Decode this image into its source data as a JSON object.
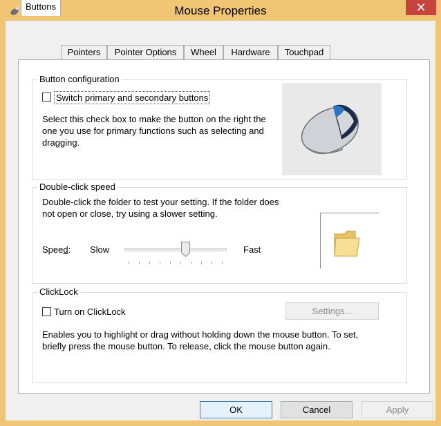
{
  "window": {
    "title": "Mouse Properties",
    "close_label": "✕"
  },
  "tabs": [
    {
      "label": "Buttons",
      "active": true
    },
    {
      "label": "Pointers",
      "active": false
    },
    {
      "label": "Pointer Options",
      "active": false
    },
    {
      "label": "Wheel",
      "active": false
    },
    {
      "label": "Hardware",
      "active": false
    },
    {
      "label": "Touchpad",
      "active": false
    }
  ],
  "button_config": {
    "group_label": "Button configuration",
    "checkbox_label": "Switch primary and secondary buttons",
    "checkbox_checked": false,
    "description": "Select this check box to make the button on the right the one you use for primary functions such as selecting and dragging."
  },
  "double_click": {
    "group_label": "Double-click speed",
    "description": "Double-click the folder to test your setting. If the folder does not open or close, try using a slower setting.",
    "speed_label": "Speed:",
    "slow_label": "Slow",
    "fast_label": "Fast",
    "speed_value": 0.6
  },
  "clicklock": {
    "group_label": "ClickLock",
    "checkbox_label": "Turn on ClickLock",
    "checkbox_checked": false,
    "settings_button": "Settings...",
    "description": "Enables you to highlight or drag without holding down the mouse button. To set, briefly press the mouse button. To release, click the mouse button again."
  },
  "footer": {
    "ok": "OK",
    "cancel": "Cancel",
    "apply": "Apply"
  }
}
